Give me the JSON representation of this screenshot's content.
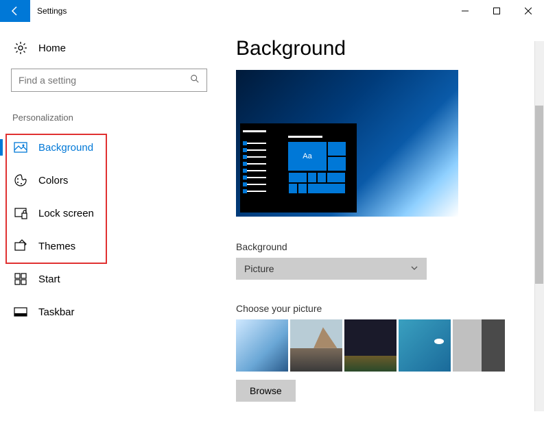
{
  "titlebar": {
    "app_name": "Settings"
  },
  "sidebar": {
    "home_label": "Home",
    "search_placeholder": "Find a setting",
    "section_label": "Personalization",
    "items": [
      {
        "label": "Background",
        "active": true
      },
      {
        "label": "Colors",
        "active": false
      },
      {
        "label": "Lock screen",
        "active": false
      },
      {
        "label": "Themes",
        "active": false
      },
      {
        "label": "Start",
        "active": false
      },
      {
        "label": "Taskbar",
        "active": false
      }
    ]
  },
  "main": {
    "heading": "Background",
    "preview_tile_text": "Aa",
    "bg_type_label": "Background",
    "bg_type_value": "Picture",
    "choose_picture_label": "Choose your picture",
    "browse_label": "Browse"
  },
  "annotation": {
    "highlight_box": {
      "covers_items": [
        "Background",
        "Colors",
        "Lock screen",
        "Themes"
      ]
    }
  }
}
